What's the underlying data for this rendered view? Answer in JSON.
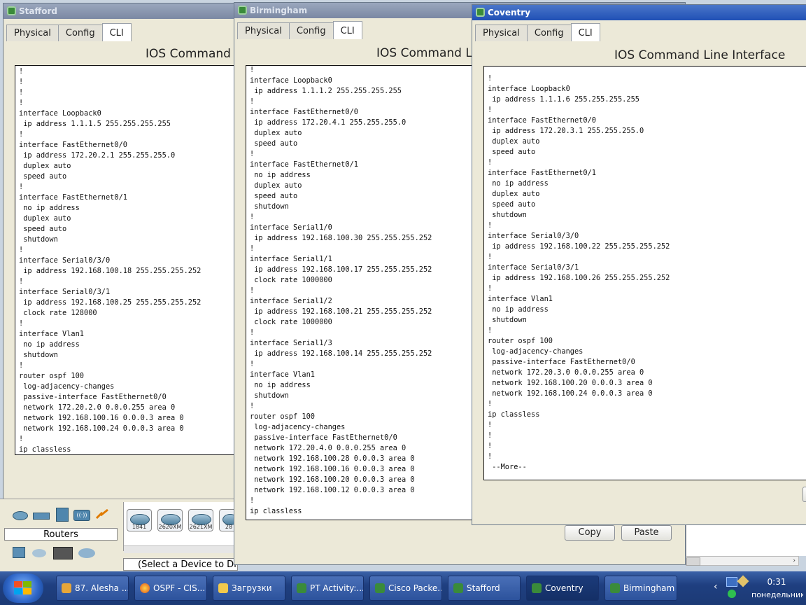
{
  "windows": {
    "stafford": {
      "title": "Stafford",
      "tabs": [
        "Physical",
        "Config",
        "CLI"
      ],
      "heading": "IOS Command Line Interface",
      "lines": [
        "!",
        "!",
        "!",
        "!",
        "interface Loopback0",
        " ip address 1.1.1.5 255.255.255.255",
        "!",
        "interface FastEthernet0/0",
        " ip address 172.20.2.1 255.255.255.0",
        " duplex auto",
        " speed auto",
        "!",
        "interface FastEthernet0/1",
        " no ip address",
        " duplex auto",
        " speed auto",
        " shutdown",
        "!",
        "interface Serial0/3/0",
        " ip address 192.168.100.18 255.255.255.252",
        "!",
        "interface Serial0/3/1",
        " ip address 192.168.100.25 255.255.255.252",
        " clock rate 128000",
        "!",
        "interface Vlan1",
        " no ip address",
        " shutdown",
        "!",
        "router ospf 100",
        " log-adjacency-changes",
        " passive-interface FastEthernet0/0",
        " network 172.20.2.0 0.0.0.255 area 0",
        " network 192.168.100.16 0.0.0.3 area 0",
        " network 192.168.100.24 0.0.0.3 area 0",
        "!",
        "ip classless",
        "!"
      ]
    },
    "birmingham": {
      "title": "Birmingham",
      "tabs": [
        "Physical",
        "Config",
        "CLI"
      ],
      "heading": "IOS Command Line Interface",
      "lines": [
        "!",
        "interface Loopback0",
        " ip address 1.1.1.2 255.255.255.255",
        "!",
        "interface FastEthernet0/0",
        " ip address 172.20.4.1 255.255.255.0",
        " duplex auto",
        " speed auto",
        "!",
        "interface FastEthernet0/1",
        " no ip address",
        " duplex auto",
        " speed auto",
        " shutdown",
        "!",
        "interface Serial1/0",
        " ip address 192.168.100.30 255.255.255.252",
        "!",
        "interface Serial1/1",
        " ip address 192.168.100.17 255.255.255.252",
        " clock rate 1000000",
        "!",
        "interface Serial1/2",
        " ip address 192.168.100.21 255.255.255.252",
        " clock rate 1000000",
        "!",
        "interface Serial1/3",
        " ip address 192.168.100.14 255.255.255.252",
        "!",
        "interface Vlan1",
        " no ip address",
        " shutdown",
        "!",
        "router ospf 100",
        " log-adjacency-changes",
        " passive-interface FastEthernet0/0",
        " network 172.20.4.0 0.0.0.255 area 0",
        " network 192.168.100.28 0.0.0.3 area 0",
        " network 192.168.100.16 0.0.0.3 area 0",
        " network 192.168.100.20 0.0.0.3 area 0",
        " network 192.168.100.12 0.0.0.3 area 0",
        "!",
        "ip classless"
      ],
      "copy_label": "Copy",
      "paste_label": "Paste"
    },
    "coventry": {
      "title": "Coventry",
      "tabs": [
        "Physical",
        "Config",
        "CLI"
      ],
      "heading": "IOS Command Line Interface",
      "lines": [
        "!",
        "interface Loopback0",
        " ip address 1.1.1.6 255.255.255.255",
        "!",
        "interface FastEthernet0/0",
        " ip address 172.20.3.1 255.255.255.0",
        " duplex auto",
        " speed auto",
        "!",
        "interface FastEthernet0/1",
        " no ip address",
        " duplex auto",
        " speed auto",
        " shutdown",
        "!",
        "interface Serial0/3/0",
        " ip address 192.168.100.22 255.255.255.252",
        "!",
        "interface Serial0/3/1",
        " ip address 192.168.100.26 255.255.255.252",
        "!",
        "interface Vlan1",
        " no ip address",
        " shutdown",
        "!",
        "router ospf 100",
        " log-adjacency-changes",
        " passive-interface FastEthernet0/0",
        " network 172.20.3.0 0.0.0.255 area 0",
        " network 192.168.100.20 0.0.0.3 area 0",
        " network 192.168.100.24 0.0.0.3 area 0",
        "!",
        "ip classless",
        "!",
        "!",
        "!",
        "!",
        " --More--"
      ]
    }
  },
  "device_panel": {
    "category_label": "Routers",
    "devices": [
      "1841",
      "2620XM",
      "2621XM",
      "28"
    ],
    "status_text": "(Select a Device to Dr"
  },
  "taskbar": {
    "items": [
      "87. Alesha ...",
      "OSPF - CIS...",
      "Загрузки",
      "PT Activity:...",
      "Cisco Packe...",
      "Stafford",
      "Coventry",
      "Birmingham"
    ],
    "active": "Coventry",
    "clock_time": "0:31",
    "clock_day": "понедельник"
  },
  "colors": {
    "active_title": "#2050b5",
    "inactive_title": "#7b88a3",
    "taskbar": "#1f3f80"
  }
}
